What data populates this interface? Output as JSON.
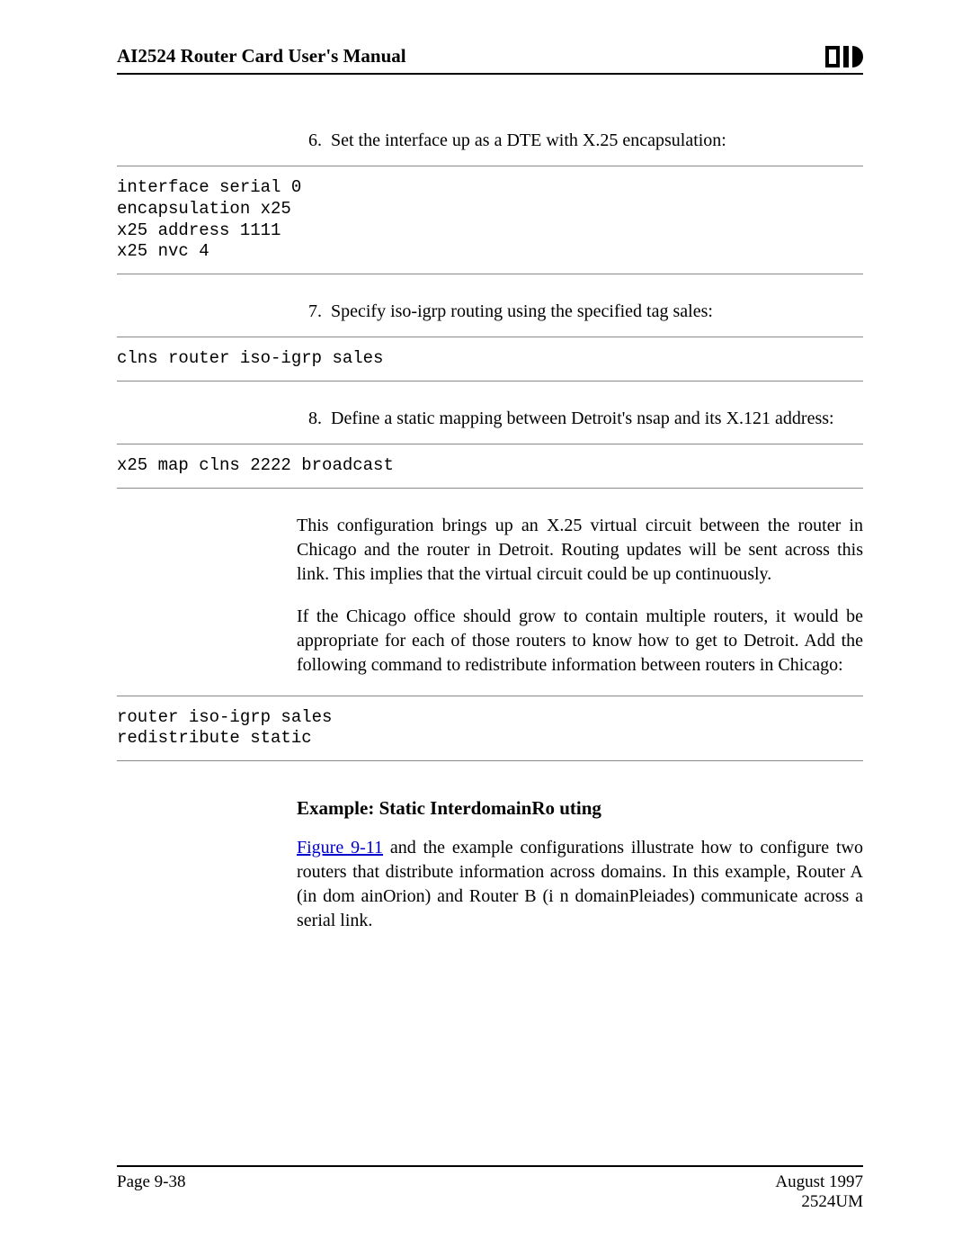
{
  "header": {
    "title": "AI2524 Router Card User's Manual"
  },
  "steps": {
    "s6": {
      "num": "6.",
      "text": "Set the interface up as a DTE with X.25 encapsulation:"
    },
    "s7": {
      "num": "7.",
      "text": "Specify iso-igrp routing using the specified tag sales:"
    },
    "s8": {
      "num": "8.",
      "text": "Define a static mapping between Detroit's nsap and its X.121 address:"
    }
  },
  "code": {
    "c1": "interface serial 0\nencapsulation x25\nx25 address 1111\nx25 nvc 4",
    "c2": "clns router iso-igrp sales",
    "c3": "x25 map clns 2222 broadcast",
    "c4": "router iso-igrp sales\nredistribute static"
  },
  "paras": {
    "p1": "This configuration brings up an X.25 virtual circuit between the router in Chicago and the router in Detroit. Routing updates will be sent across this link. This implies that the virtual circuit could be up continuously.",
    "p2": "If the Chicago office should grow to contain multiple routers, it would be appropriate for each of those routers to know how to get to Detroit. Add the following command to redistribute information between routers in Chicago:"
  },
  "subhead": "Example: Static InterdomainRo uting",
  "fig": {
    "link": "Figure 9-11",
    "rest": " and the example configurations illustrate how to configure two routers that distribute information across domains. In this example, Router A (in dom ainOrion) and Router B (i n domainPleiades) communicate across a serial link."
  },
  "footer": {
    "page": "Page 9-38",
    "date": "August 1997",
    "doc": "2524UM"
  }
}
